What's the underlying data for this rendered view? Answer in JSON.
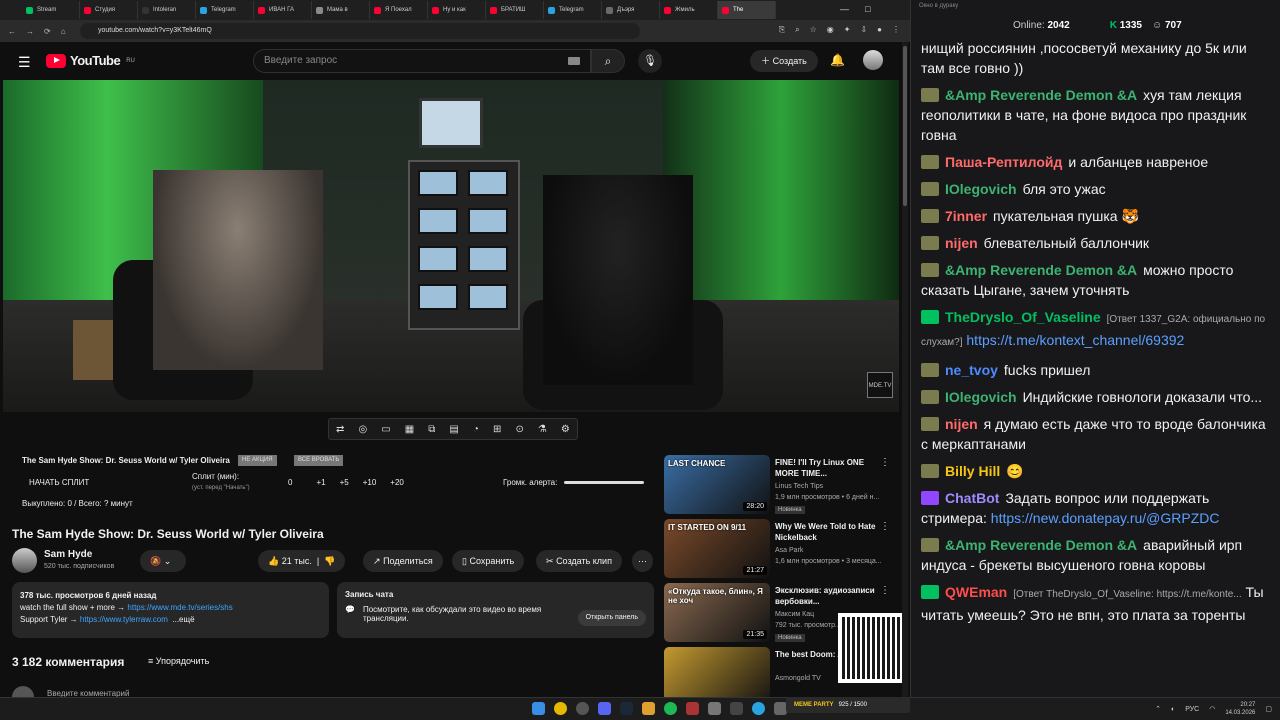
{
  "tabs": [
    {
      "label": "Stream",
      "color": "#00c060"
    },
    {
      "label": "Студия",
      "color": "#ff0033"
    },
    {
      "label": "Intoleran",
      "color": "#333"
    },
    {
      "label": "Telegram",
      "color": "#2aa3e0"
    },
    {
      "label": "ИВАН ГА",
      "color": "#ff0033"
    },
    {
      "label": "Мама в",
      "color": "#8a8a8a"
    },
    {
      "label": "Я Поехал",
      "color": "#ff0033"
    },
    {
      "label": "Ну и как",
      "color": "#ff0033"
    },
    {
      "label": "БРАТИШ",
      "color": "#ff0033"
    },
    {
      "label": "Telegram",
      "color": "#2aa3e0"
    },
    {
      "label": "Дъэря",
      "color": "#6a6a6a"
    },
    {
      "label": "Жмиль",
      "color": "#ff0033"
    },
    {
      "label": "The",
      "color": "#ff0033"
    }
  ],
  "address": {
    "url": "youtube.com/watch?v=y3KTelt46mQ"
  },
  "header": {
    "logo": "YouTube",
    "region": "RU",
    "search_placeholder": "Введите запрос",
    "create": "Создать"
  },
  "video": {
    "watermark": "MDE.TV"
  },
  "split": {
    "title": "The Sam Hyde Show: Dr. Seuss World w/ Tyler Oliveira",
    "badge1": "НЕ АКЦИЯ",
    "badge2": "ВСЕ ВРОВАТЬ",
    "start": "НАЧАТЬ СПЛИТ",
    "split_min": "Сплит (мин):",
    "split_sub": "(уст. перед \"Начать\")",
    "n0": "0",
    "n1": "+1",
    "n2": "+5",
    "n3": "+10",
    "n4": "+20",
    "alert": "Громк. алерта:",
    "paid": "Выкуплено: 0 / Всего: ? минут"
  },
  "title": "The Sam Hyde Show: Dr. Seuss World w/ Tyler Oliveira",
  "channel": {
    "name": "Sam Hyde",
    "subs": "520 тыс. подписчиков"
  },
  "actions": {
    "likes": "21 тыс.",
    "share": "Поделиться",
    "save": "Сохранить",
    "clip": "Создать клип"
  },
  "description": {
    "stats": "378 тыс. просмотров  6 дней назад",
    "line1": "watch the full show + more → ",
    "link1": "https://www.mde.tv/series/shs",
    "line2": "Support Tyler → ",
    "link2": "https://www.tylerraw.com",
    "more": "...ещё"
  },
  "chatrec": {
    "title": "Запись чата",
    "text": "Посмотрите, как обсуждали это видео во время трансляции.",
    "button": "Открыть панель"
  },
  "comments": {
    "count": "3 182 комментария",
    "sort": "Упорядочить",
    "add": "Введите комментарий"
  },
  "recs": [
    {
      "title": "FINE! I'll Try Linux ONE MORE TIME...",
      "channel": "Linus Tech Tips",
      "meta": "1,9 млн просмотров • 6 дней н...",
      "badge": "Новинка",
      "dur": "28:20",
      "thumb_text": "LAST CHANCE",
      "color": "#3a6ea5"
    },
    {
      "title": "Why We Were Told to Hate Nickelback",
      "channel": "Asa Park",
      "meta": "1,6 млн просмотров • 3 месяца...",
      "badge": "",
      "dur": "21:27",
      "thumb_text": "IT STARTED ON 9/11",
      "color": "#7a4a2a"
    },
    {
      "title": "Эксклюзив: аудиозаписи вербовки...",
      "channel": "Максим Кац",
      "meta": "792 тыс. просмотр...",
      "badge": "Новинка",
      "dur": "21:35",
      "thumb_text": "«Откуда такое, блин», Я не хоч",
      "color": "#8a6a50"
    },
    {
      "title": "The best Doom: Ages review",
      "channel": "Asmongold TV",
      "meta": "",
      "badge": "",
      "dur": "",
      "thumb_text": "",
      "color": "#c49a30"
    }
  ],
  "chat": {
    "header": "Окно в дураку",
    "online_label": "Online:",
    "online": "2042",
    "count1": "1335",
    "count2": "707"
  },
  "messages": [
    {
      "name": "",
      "color": "#fff",
      "text": "нищий россиянин ,пососветуй механику до 5к или там все говно ))",
      "icon": ""
    },
    {
      "name": "&Amp Reverende Demon &A",
      "color": "#3cb371",
      "text": "хуя там лекция геополитики в чате, на фоне видоса про праздник говна",
      "icon": "f"
    },
    {
      "name": "Паша-Рептилойд",
      "color": "#ff6b6b",
      "text": "и албанцев навреное",
      "icon": "f"
    },
    {
      "name": "IOlegovich",
      "color": "#3cb371",
      "text": "бля это ужас",
      "icon": "f"
    },
    {
      "name": "7inner",
      "color": "#ff6b6b",
      "text": "пукательная пушка 🐯",
      "icon": "f"
    },
    {
      "name": "nijen",
      "color": "#ff6b6b",
      "text": "блевательный баллончик",
      "icon": "f"
    },
    {
      "name": "&Amp Reverende Demon &A",
      "color": "#3cb371",
      "text": "можно просто сказать Цыгане, зачем уточнять",
      "icon": "f"
    },
    {
      "name": "TheDryslo_Of_Vaseline",
      "color": "#00c060",
      "reply": "[Ответ 1337_G2A: официально по слухам?]",
      "link": "https://t.me/kontext_channel/69392",
      "text": "",
      "icon": "g"
    },
    {
      "name": "ne_tvoy",
      "color": "#4d8bff",
      "text": "fucks пришел",
      "icon": "f"
    },
    {
      "name": "IOlegovich",
      "color": "#3cb371",
      "text": "Индийские говнологи доказали что...",
      "icon": "f"
    },
    {
      "name": "nijen",
      "color": "#ff6b6b",
      "text": "я думаю есть даже что то вроде балончика с меркаптанами",
      "icon": "f"
    },
    {
      "name": "Billy Hill",
      "color": "#f5c518",
      "text": "😊",
      "icon": "f"
    },
    {
      "name": "ChatBot",
      "color": "#9c8cff",
      "text": "Задать вопрос или поддержать стримера: ",
      "link": "https://new.donatepay.ru/@GRPZDC",
      "icon": "p"
    },
    {
      "name": "&Amp Reverende Demon &A",
      "color": "#3cb371",
      "text": "аварийный ирп индуса - брекеты высушеного говна коровы",
      "icon": "f"
    },
    {
      "name": "QWEman",
      "color": "#ff4d4d",
      "reply": "[Ответ TheDryslo_Of_Vaseline: https://t.me/konte...",
      "text": "Ты читать умеешь? Это не впн, это плата за торенты",
      "icon": "g"
    }
  ],
  "taskbar": {
    "lang": "РУС",
    "time": "20:27",
    "date": "14.03.2026",
    "meme": "MEME PARTY",
    "meme_count": "925 / 1500"
  }
}
